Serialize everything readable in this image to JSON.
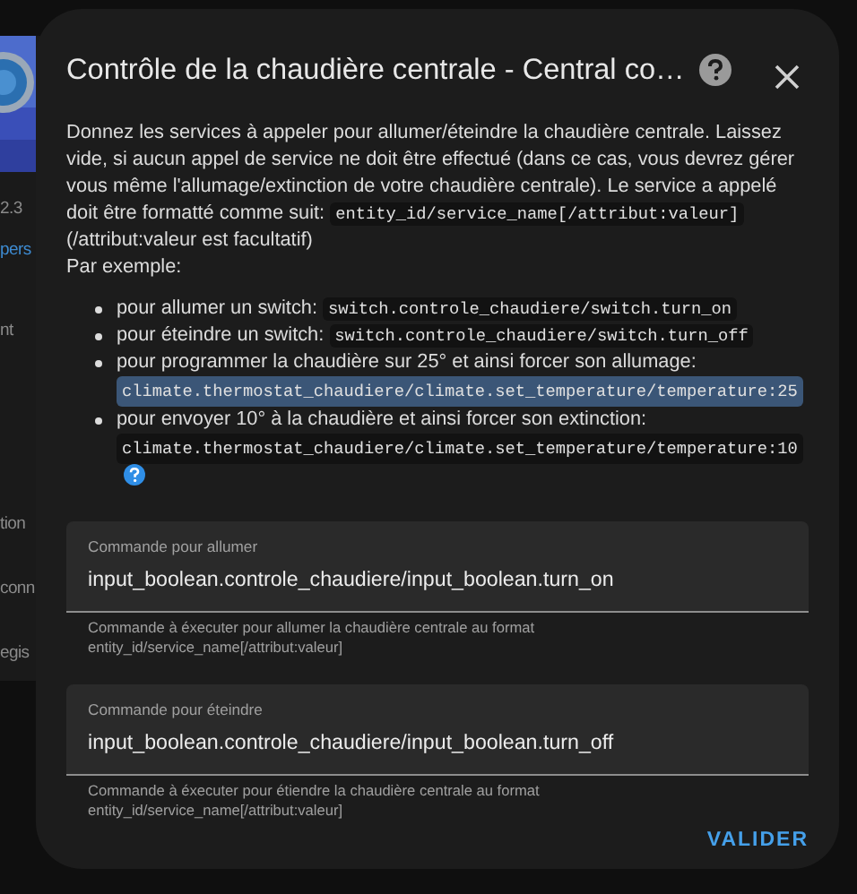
{
  "background": {
    "items": [
      {
        "text": "2.3",
        "kind": "text"
      },
      {
        "text": "pers",
        "kind": "link"
      },
      {
        "text": "nt",
        "kind": "text"
      },
      {
        "text": "tion",
        "kind": "text"
      },
      {
        "text": "conn",
        "kind": "text"
      },
      {
        "text": "egis",
        "kind": "text"
      }
    ]
  },
  "dialog": {
    "title": "Contrôle de la chaudière centrale - Central co…",
    "intro": {
      "text": "Donnez les services à appeler pour allumer/éteindre la chaudière centrale. Laissez vide, si aucun appel de service ne doit être effectué (dans ce cas, vous devrez gérer vous même l'allumage/extinction de votre chaudière centrale). Le service a appelé doit être formatté comme suit:",
      "code": "entity_id/service_name[/attribut:valeur]",
      "after": "(/attribut:valeur est facultatif)",
      "example_label": "Par exemple:"
    },
    "examples": [
      {
        "text": "pour allumer un switch:",
        "code": "switch.controle_chaudiere/switch.turn_on",
        "highlighted": false,
        "help": false
      },
      {
        "text": "pour éteindre un switch:",
        "code": "switch.controle_chaudiere/switch.turn_off",
        "highlighted": false,
        "help": false
      },
      {
        "text": "pour programmer la chaudière sur 25° et ainsi forcer son allumage:",
        "code": "climate.thermostat_chaudiere/climate.set_temperature/temperature:25",
        "highlighted": true,
        "help": false
      },
      {
        "text": "pour envoyer 10° à la chaudière et ainsi forcer son extinction:",
        "code": "climate.thermostat_chaudiere/climate.set_temperature/temperature:10",
        "highlighted": false,
        "help": true
      }
    ],
    "fields": [
      {
        "label": "Commande pour allumer",
        "value": "input_boolean.controle_chaudiere/input_boolean.turn_on",
        "helper": "Commande à éxecuter pour allumer la chaudière centrale au format entity_id/service_name[/attribut:valeur]"
      },
      {
        "label": "Commande pour éteindre",
        "value": "input_boolean.controle_chaudiere/input_boolean.turn_off",
        "helper": "Commande à éxecuter pour étiendre la chaudière centrale au format entity_id/service_name[/attribut:valeur]"
      }
    ],
    "submit": "VALIDER"
  }
}
